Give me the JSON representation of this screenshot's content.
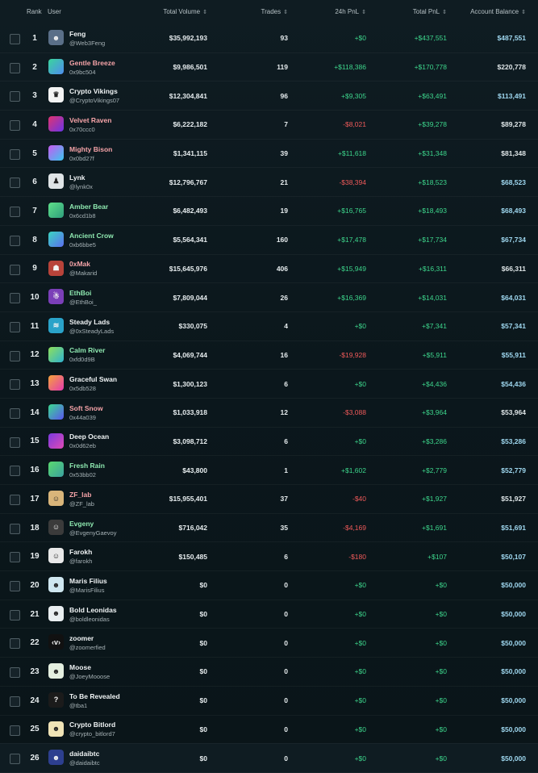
{
  "header": {
    "rank": "Rank",
    "user": "User",
    "total_volume": "Total Volume",
    "trades": "Trades",
    "pnl_24h": "24h PnL",
    "total_pnl": "Total PnL",
    "account_balance": "Account Balance",
    "sort_icon": "updown-arrows-icon"
  },
  "rows": [
    {
      "rank": "1",
      "name": "Feng",
      "handle": "@Web3Feng",
      "volume": "$35,992,193",
      "trades": "93",
      "pnl24": "+$0",
      "pnl": "+$437,551",
      "balance": "$487,551",
      "name_style": "white",
      "avatar": "photo",
      "avatar_bg": "#5a6f88",
      "avatar_glyph": "☻",
      "pnl24_sign": "pos",
      "balance_style": "hi"
    },
    {
      "rank": "2",
      "name": "Gentle Breeze",
      "handle": "0x9bc504",
      "volume": "$9,986,501",
      "trades": "119",
      "pnl24": "+$118,386",
      "pnl": "+$170,778",
      "balance": "$220,778",
      "name_style": "pink",
      "avatar": "gradient",
      "avatar_bg": "linear-gradient(135deg,#3ad59b,#4f8cf0)",
      "avatar_glyph": "",
      "pnl24_sign": "pos",
      "balance_style": "lo"
    },
    {
      "rank": "3",
      "name": "Crypto Vikings",
      "handle": "@CryptoVikings07",
      "volume": "$12,304,841",
      "trades": "96",
      "pnl24": "+$9,305",
      "pnl": "+$63,491",
      "balance": "$113,491",
      "name_style": "white",
      "avatar": "photo",
      "avatar_bg": "#f3f3f3",
      "avatar_glyph": "♛",
      "pnl24_sign": "pos",
      "balance_style": "hi"
    },
    {
      "rank": "4",
      "name": "Velvet Raven",
      "handle": "0x70ccc0",
      "volume": "$6,222,182",
      "trades": "7",
      "pnl24": "-$8,021",
      "pnl": "+$39,278",
      "balance": "$89,278",
      "name_style": "pink",
      "avatar": "gradient",
      "avatar_bg": "linear-gradient(135deg,#e0336f,#6b35e8)",
      "avatar_glyph": "",
      "pnl24_sign": "neg",
      "balance_style": "lo"
    },
    {
      "rank": "5",
      "name": "Mighty Bison",
      "handle": "0x0bd27f",
      "volume": "$1,341,115",
      "trades": "39",
      "pnl24": "+$11,618",
      "pnl": "+$31,348",
      "balance": "$81,348",
      "name_style": "pink",
      "avatar": "gradient",
      "avatar_bg": "linear-gradient(135deg,#c85af0,#39c7f0)",
      "avatar_glyph": "",
      "pnl24_sign": "pos",
      "balance_style": "lo"
    },
    {
      "rank": "6",
      "name": "Lynk",
      "handle": "@lynk0x",
      "volume": "$12,796,767",
      "trades": "21",
      "pnl24": "-$38,394",
      "pnl": "+$18,523",
      "balance": "$68,523",
      "name_style": "white",
      "avatar": "photo",
      "avatar_bg": "#dfe4e6",
      "avatar_glyph": "♟",
      "pnl24_sign": "neg",
      "balance_style": "hi"
    },
    {
      "rank": "7",
      "name": "Amber Bear",
      "handle": "0x6cd1b8",
      "volume": "$6,482,493",
      "trades": "19",
      "pnl24": "+$16,765",
      "pnl": "+$18,493",
      "balance": "$68,493",
      "name_style": "green",
      "avatar": "gradient",
      "avatar_bg": "linear-gradient(135deg,#5fe08a,#2e9e7c)",
      "avatar_glyph": "",
      "pnl24_sign": "pos",
      "balance_style": "hi"
    },
    {
      "rank": "8",
      "name": "Ancient Crow",
      "handle": "0xb6bbe5",
      "volume": "$5,564,341",
      "trades": "160",
      "pnl24": "+$17,478",
      "pnl": "+$17,734",
      "balance": "$67,734",
      "name_style": "green",
      "avatar": "gradient",
      "avatar_bg": "linear-gradient(135deg,#3ad5c0,#5b6ef0)",
      "avatar_glyph": "",
      "pnl24_sign": "pos",
      "balance_style": "hi"
    },
    {
      "rank": "9",
      "name": "0xMak",
      "handle": "@Makarid",
      "volume": "$15,645,976",
      "trades": "406",
      "pnl24": "+$15,949",
      "pnl": "+$16,311",
      "balance": "$66,311",
      "name_style": "pink",
      "avatar": "photo",
      "avatar_bg": "#b8433a",
      "avatar_glyph": "☗",
      "pnl24_sign": "pos",
      "balance_style": "lo"
    },
    {
      "rank": "10",
      "name": "EthBoi",
      "handle": "@EthBoi_",
      "volume": "$7,809,044",
      "trades": "26",
      "pnl24": "+$16,369",
      "pnl": "+$14,031",
      "balance": "$64,031",
      "name_style": "green",
      "avatar": "photo",
      "avatar_bg": "#7b3fb8",
      "avatar_glyph": "☃",
      "pnl24_sign": "pos",
      "balance_style": "hi"
    },
    {
      "rank": "11",
      "name": "Steady Lads",
      "handle": "@0xSteadyLads",
      "volume": "$330,075",
      "trades": "4",
      "pnl24": "+$0",
      "pnl": "+$7,341",
      "balance": "$57,341",
      "name_style": "white",
      "avatar": "photo",
      "avatar_bg": "#2aa3c9",
      "avatar_glyph": "≋",
      "pnl24_sign": "pos",
      "balance_style": "hi"
    },
    {
      "rank": "12",
      "name": "Calm River",
      "handle": "0xfd0d9B",
      "volume": "$4,069,744",
      "trades": "16",
      "pnl24": "-$19,928",
      "pnl": "+$5,911",
      "balance": "$55,911",
      "name_style": "green",
      "avatar": "gradient",
      "avatar_bg": "linear-gradient(135deg,#8fe05a,#2fb2d0)",
      "avatar_glyph": "",
      "pnl24_sign": "neg",
      "balance_style": "hi"
    },
    {
      "rank": "13",
      "name": "Graceful Swan",
      "handle": "0x5db528",
      "volume": "$1,300,123",
      "trades": "6",
      "pnl24": "+$0",
      "pnl": "+$4,436",
      "balance": "$54,436",
      "name_style": "white",
      "avatar": "gradient",
      "avatar_bg": "linear-gradient(135deg,#f5a43a,#e53ab0)",
      "avatar_glyph": "",
      "pnl24_sign": "pos",
      "balance_style": "hi"
    },
    {
      "rank": "14",
      "name": "Soft Snow",
      "handle": "0x44a039",
      "volume": "$1,033,918",
      "trades": "12",
      "pnl24": "-$3,088",
      "pnl": "+$3,964",
      "balance": "$53,964",
      "name_style": "pink",
      "avatar": "gradient",
      "avatar_bg": "linear-gradient(135deg,#3adb8f,#5a55f0)",
      "avatar_glyph": "",
      "pnl24_sign": "neg",
      "balance_style": "lo"
    },
    {
      "rank": "15",
      "name": "Deep Ocean",
      "handle": "0x0d62eb",
      "volume": "$3,098,712",
      "trades": "6",
      "pnl24": "+$0",
      "pnl": "+$3,286",
      "balance": "$53,286",
      "name_style": "white",
      "avatar": "gradient",
      "avatar_bg": "linear-gradient(135deg,#7a3ae0,#e04ab5)",
      "avatar_glyph": "",
      "pnl24_sign": "pos",
      "balance_style": "hi"
    },
    {
      "rank": "16",
      "name": "Fresh Rain",
      "handle": "0x53bb02",
      "volume": "$43,800",
      "trades": "1",
      "pnl24": "+$1,602",
      "pnl": "+$2,779",
      "balance": "$52,779",
      "name_style": "green",
      "avatar": "gradient",
      "avatar_bg": "linear-gradient(135deg,#5ad96e,#3aa0a0)",
      "avatar_glyph": "",
      "pnl24_sign": "pos",
      "balance_style": "hi"
    },
    {
      "rank": "17",
      "name": "ZF_lab",
      "handle": "@ZF_lab",
      "volume": "$15,955,401",
      "trades": "37",
      "pnl24": "-$40",
      "pnl": "+$1,927",
      "balance": "$51,927",
      "name_style": "pink",
      "avatar": "photo",
      "avatar_bg": "#d9b57a",
      "avatar_glyph": "☺",
      "pnl24_sign": "neg",
      "balance_style": "lo"
    },
    {
      "rank": "18",
      "name": "Evgeny",
      "handle": "@EvgenyGaevoy",
      "volume": "$716,042",
      "trades": "35",
      "pnl24": "-$4,169",
      "pnl": "+$1,691",
      "balance": "$51,691",
      "name_style": "green",
      "avatar": "photo",
      "avatar_bg": "#3b3b3b",
      "avatar_glyph": "☺",
      "pnl24_sign": "neg",
      "balance_style": "hi"
    },
    {
      "rank": "19",
      "name": "Farokh",
      "handle": "@farokh",
      "volume": "$150,485",
      "trades": "6",
      "pnl24": "-$180",
      "pnl": "+$107",
      "balance": "$50,107",
      "name_style": "white",
      "avatar": "photo",
      "avatar_bg": "#e8e8e8",
      "avatar_glyph": "☺",
      "pnl24_sign": "neg",
      "balance_style": "hi"
    },
    {
      "rank": "20",
      "name": "Maris Filius",
      "handle": "@MarisFilius",
      "volume": "$0",
      "trades": "0",
      "pnl24": "+$0",
      "pnl": "+$0",
      "balance": "$50,000",
      "name_style": "white",
      "avatar": "photo",
      "avatar_bg": "#cfe7f0",
      "avatar_glyph": "☻",
      "pnl24_sign": "pos",
      "balance_style": "hi"
    },
    {
      "rank": "21",
      "name": "Bold Leonidas",
      "handle": "@boldleonidas",
      "volume": "$0",
      "trades": "0",
      "pnl24": "+$0",
      "pnl": "+$0",
      "balance": "$50,000",
      "name_style": "white",
      "avatar": "photo",
      "avatar_bg": "#e9eef0",
      "avatar_glyph": "☻",
      "pnl24_sign": "pos",
      "balance_style": "hi"
    },
    {
      "rank": "22",
      "name": "zoomer",
      "handle": "@zoomerfied",
      "volume": "$0",
      "trades": "0",
      "pnl24": "+$0",
      "pnl": "+$0",
      "balance": "$50,000",
      "name_style": "white",
      "avatar": "photo",
      "avatar_bg": "#111111",
      "avatar_glyph": "‹v›",
      "pnl24_sign": "pos",
      "balance_style": "hi"
    },
    {
      "rank": "23",
      "name": "Moose",
      "handle": "@JoeyMooose",
      "volume": "$0",
      "trades": "0",
      "pnl24": "+$0",
      "pnl": "+$0",
      "balance": "$50,000",
      "name_style": "white",
      "avatar": "photo",
      "avatar_bg": "#e4efe0",
      "avatar_glyph": "☻",
      "pnl24_sign": "pos",
      "balance_style": "hi"
    },
    {
      "rank": "24",
      "name": "To Be Revealed",
      "handle": "@tba1",
      "volume": "$0",
      "trades": "0",
      "pnl24": "+$0",
      "pnl": "+$0",
      "balance": "$50,000",
      "name_style": "white",
      "avatar": "photo",
      "avatar_bg": "#1b1b1b",
      "avatar_glyph": "?",
      "pnl24_sign": "pos",
      "balance_style": "hi"
    },
    {
      "rank": "25",
      "name": "Crypto Bitlord",
      "handle": "@crypto_bitlord7",
      "volume": "$0",
      "trades": "0",
      "pnl24": "+$0",
      "pnl": "+$0",
      "balance": "$50,000",
      "name_style": "white",
      "avatar": "photo",
      "avatar_bg": "#efe3b6",
      "avatar_glyph": "☻",
      "pnl24_sign": "pos",
      "balance_style": "hi"
    },
    {
      "rank": "26",
      "name": "daidaibtc",
      "handle": "@daidaibtc",
      "volume": "$0",
      "trades": "0",
      "pnl24": "+$0",
      "pnl": "+$0",
      "balance": "$50,000",
      "name_style": "white",
      "avatar": "photo",
      "avatar_bg": "#2d3f8f",
      "avatar_glyph": "☻",
      "pnl24_sign": "pos",
      "balance_style": "hi"
    }
  ]
}
